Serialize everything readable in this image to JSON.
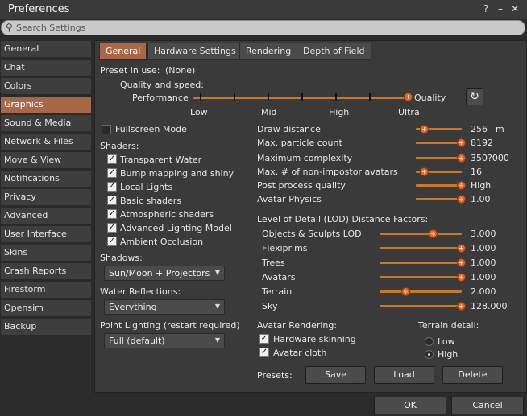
{
  "window": {
    "title": "Preferences",
    "help": "?",
    "minimize": "–",
    "close": "✕"
  },
  "search": {
    "placeholder": "Search Settings"
  },
  "sidebar": {
    "items": [
      {
        "label": "General"
      },
      {
        "label": "Chat"
      },
      {
        "label": "Colors"
      },
      {
        "label": "Graphics"
      },
      {
        "label": "Sound & Media"
      },
      {
        "label": "Network & Files"
      },
      {
        "label": "Move & View"
      },
      {
        "label": "Notifications"
      },
      {
        "label": "Privacy"
      },
      {
        "label": "Advanced"
      },
      {
        "label": "User Interface"
      },
      {
        "label": "Skins"
      },
      {
        "label": "Crash Reports"
      },
      {
        "label": "Firestorm"
      },
      {
        "label": "Opensim"
      },
      {
        "label": "Backup"
      }
    ],
    "selected": "Graphics"
  },
  "tabs": [
    {
      "label": "General"
    },
    {
      "label": "Hardware Settings"
    },
    {
      "label": "Rendering"
    },
    {
      "label": "Depth of Field"
    }
  ],
  "preset": {
    "label": "Preset in use:",
    "value": "(None)"
  },
  "quality": {
    "heading": "Quality and speed:",
    "left": "Performance",
    "right": "Quality",
    "ticks": [
      "Low",
      "Mid",
      "High",
      "Ultra"
    ],
    "level": 1.0,
    "reset_icon": "refresh-icon"
  },
  "fullscreen": {
    "label": "Fullscreen Mode",
    "checked": false
  },
  "shaders": {
    "heading": "Shaders:",
    "items": [
      {
        "label": "Transparent Water",
        "checked": true
      },
      {
        "label": "Bump mapping and shiny",
        "checked": true
      },
      {
        "label": "Local Lights",
        "checked": true
      },
      {
        "label": "Basic shaders",
        "checked": true
      },
      {
        "label": "Atmospheric shaders",
        "checked": true
      },
      {
        "label": "Advanced Lighting Model",
        "checked": true
      },
      {
        "label": "Ambient Occlusion",
        "checked": true
      }
    ]
  },
  "shadows": {
    "label": "Shadows:",
    "value": "Sun/Moon + Projectors"
  },
  "water": {
    "label": "Water Reflections:",
    "value": "Everything"
  },
  "point_lighting": {
    "label": "Point Lighting (restart required)",
    "value": "Full (default)"
  },
  "sliders": [
    {
      "label": "Draw distance",
      "value": "256",
      "unit": "m",
      "level": 0.18
    },
    {
      "label": "Max. particle count",
      "value": "8192",
      "level": 1.0
    },
    {
      "label": "Maximum complexity",
      "value": "350?000",
      "level": 1.0
    },
    {
      "label": "Max. # of non-impostor avatars",
      "value": "16",
      "level": 0.18
    },
    {
      "label": "Post process quality",
      "value": "High",
      "level": 1.0
    },
    {
      "label": "Avatar Physics",
      "value": "1.00",
      "level": 1.0
    }
  ],
  "lod": {
    "heading": "Level of Detail (LOD) Distance Factors:",
    "items": [
      {
        "label": "Objects & Sculpts LOD",
        "value": "3.000",
        "level": 0.67
      },
      {
        "label": "Flexiprims",
        "value": "1.000",
        "level": 1.0
      },
      {
        "label": "Trees",
        "value": "1.000",
        "level": 1.0
      },
      {
        "label": "Avatars",
        "value": "1.000",
        "level": 1.0
      },
      {
        "label": "Terrain",
        "value": "2.000",
        "level": 0.3
      },
      {
        "label": "Sky",
        "value": "128.000",
        "level": 1.0
      }
    ]
  },
  "avatar_rendering": {
    "heading": "Avatar Rendering:",
    "items": [
      {
        "label": "Hardware skinning",
        "checked": true
      },
      {
        "label": "Avatar cloth",
        "checked": true
      }
    ]
  },
  "terrain_detail": {
    "heading": "Terrain detail:",
    "options": [
      {
        "label": "Low",
        "selected": false
      },
      {
        "label": "High",
        "selected": true
      }
    ]
  },
  "presets": {
    "label": "Presets:",
    "save": "Save",
    "load": "Load",
    "delete": "Delete"
  },
  "footer": {
    "ok": "OK",
    "cancel": "Cancel"
  }
}
